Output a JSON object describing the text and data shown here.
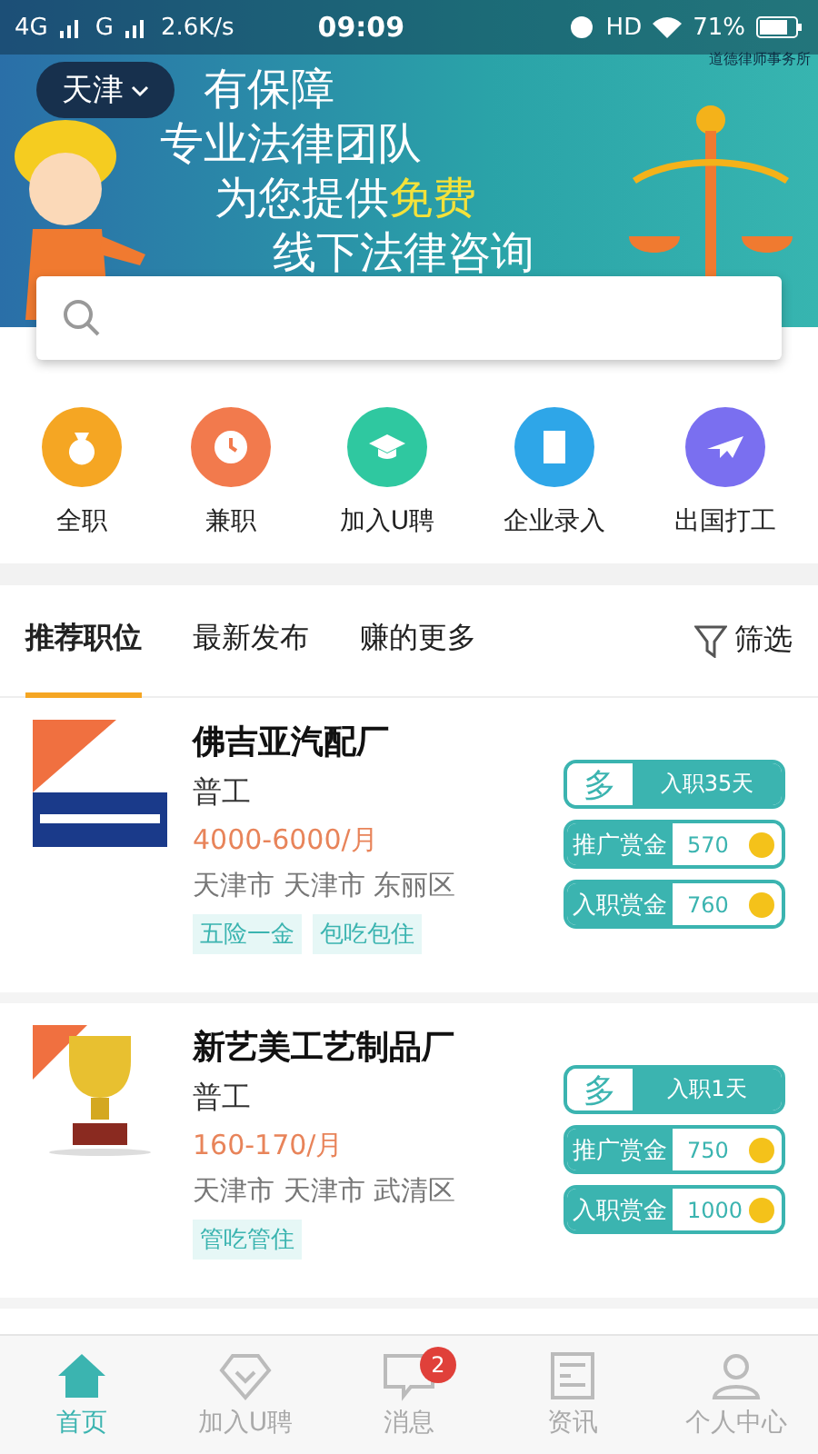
{
  "status_bar": {
    "left": "4G",
    "carrier": "G",
    "speed": "2.6K/s",
    "time": "09:09",
    "hd": "HD",
    "battery": "71%"
  },
  "banner": {
    "city": "天津",
    "lines": [
      {
        "text": "有保障"
      },
      {
        "text": "专业法律团队"
      },
      {
        "text": "为您提供",
        "highlight": "免费"
      },
      {
        "text": "线下法律咨询"
      }
    ],
    "sponsor": "道德律师事务所"
  },
  "categories": [
    {
      "label": "全职",
      "color": "#f5a623"
    },
    {
      "label": "兼职",
      "color": "#f27a4d"
    },
    {
      "label": "加入U聘",
      "color": "#2fc8a0"
    },
    {
      "label": "企业录入",
      "color": "#2ea6e8"
    },
    {
      "label": "出国打工",
      "color": "#7a6ff0"
    }
  ],
  "tabs": [
    {
      "label": "推荐职位",
      "selected": true
    },
    {
      "label": "最新发布",
      "selected": false
    },
    {
      "label": "赚的更多",
      "selected": false
    }
  ],
  "filter": "筛选",
  "jobs": [
    {
      "company": "佛吉亚汽配厂",
      "title": "普工",
      "salary": "4000-6000/月",
      "location": "天津市 天津市 东丽区",
      "tags": [
        "五险一金",
        "包吃包住"
      ],
      "badge": "多",
      "days": "入职35天",
      "rewards": [
        {
          "label": "推广赏金",
          "amount": "570"
        },
        {
          "label": "入职赏金",
          "amount": "760"
        }
      ]
    },
    {
      "company": "新艺美工艺制品厂",
      "title": "普工",
      "salary": "160-170/月",
      "location": "天津市 天津市 武清区",
      "tags": [
        "管吃管住"
      ],
      "badge": "多",
      "days": "入职1天",
      "rewards": [
        {
          "label": "推广赏金",
          "amount": "750"
        },
        {
          "label": "入职赏金",
          "amount": "1000"
        }
      ]
    }
  ],
  "nav": [
    {
      "label": "首页",
      "selected": true
    },
    {
      "label": "加入U聘",
      "selected": false
    },
    {
      "label": "消息",
      "selected": false,
      "badge": "2"
    },
    {
      "label": "资讯",
      "selected": false
    },
    {
      "label": "个人中心",
      "selected": false
    }
  ]
}
